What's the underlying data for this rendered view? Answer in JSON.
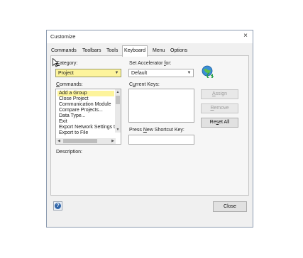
{
  "dialog": {
    "title": "Customize",
    "close_glyph": "×"
  },
  "tabs": [
    {
      "label": "Commands",
      "active": false
    },
    {
      "label": "Toolbars",
      "active": false
    },
    {
      "label": "Tools",
      "active": false
    },
    {
      "label": "Keyboard",
      "active": true
    },
    {
      "label": "Menu",
      "active": false
    },
    {
      "label": "Options",
      "active": false
    }
  ],
  "category": {
    "label_first": "C",
    "label_rest": "ategory:",
    "value": "Project",
    "highlight_color": "#fdf49c"
  },
  "accelerator": {
    "label_pre": "Set Accelerator ",
    "label_u": "f",
    "label_post": "or:",
    "value": "Default"
  },
  "commands": {
    "label_first": "C",
    "label_rest": "ommands:",
    "items": [
      "Add a Group",
      "Close Project",
      "Communication Module",
      "Compare Projects...",
      "Data Type...",
      "Exit",
      "Export Network Settings t",
      "Export to File"
    ],
    "selected_index": 0
  },
  "current_keys": {
    "label_pre": "C",
    "label_u": "u",
    "label_post": "rrent Keys:"
  },
  "shortcut": {
    "label_pre": "Press ",
    "label_u": "N",
    "label_post": "ew Shortcut Key:",
    "value": ""
  },
  "buttons": {
    "assign": {
      "first": "A",
      "rest": "ssign",
      "enabled": false
    },
    "remove": {
      "first": "R",
      "rest": "emove",
      "enabled": false
    },
    "reset_all": {
      "pre": "Re",
      "u": "s",
      "post": "et All",
      "enabled": true
    },
    "close": "Close"
  },
  "description_label": "Description:",
  "icons": {
    "globe": "globe-refresh-icon",
    "help": "help-icon"
  }
}
